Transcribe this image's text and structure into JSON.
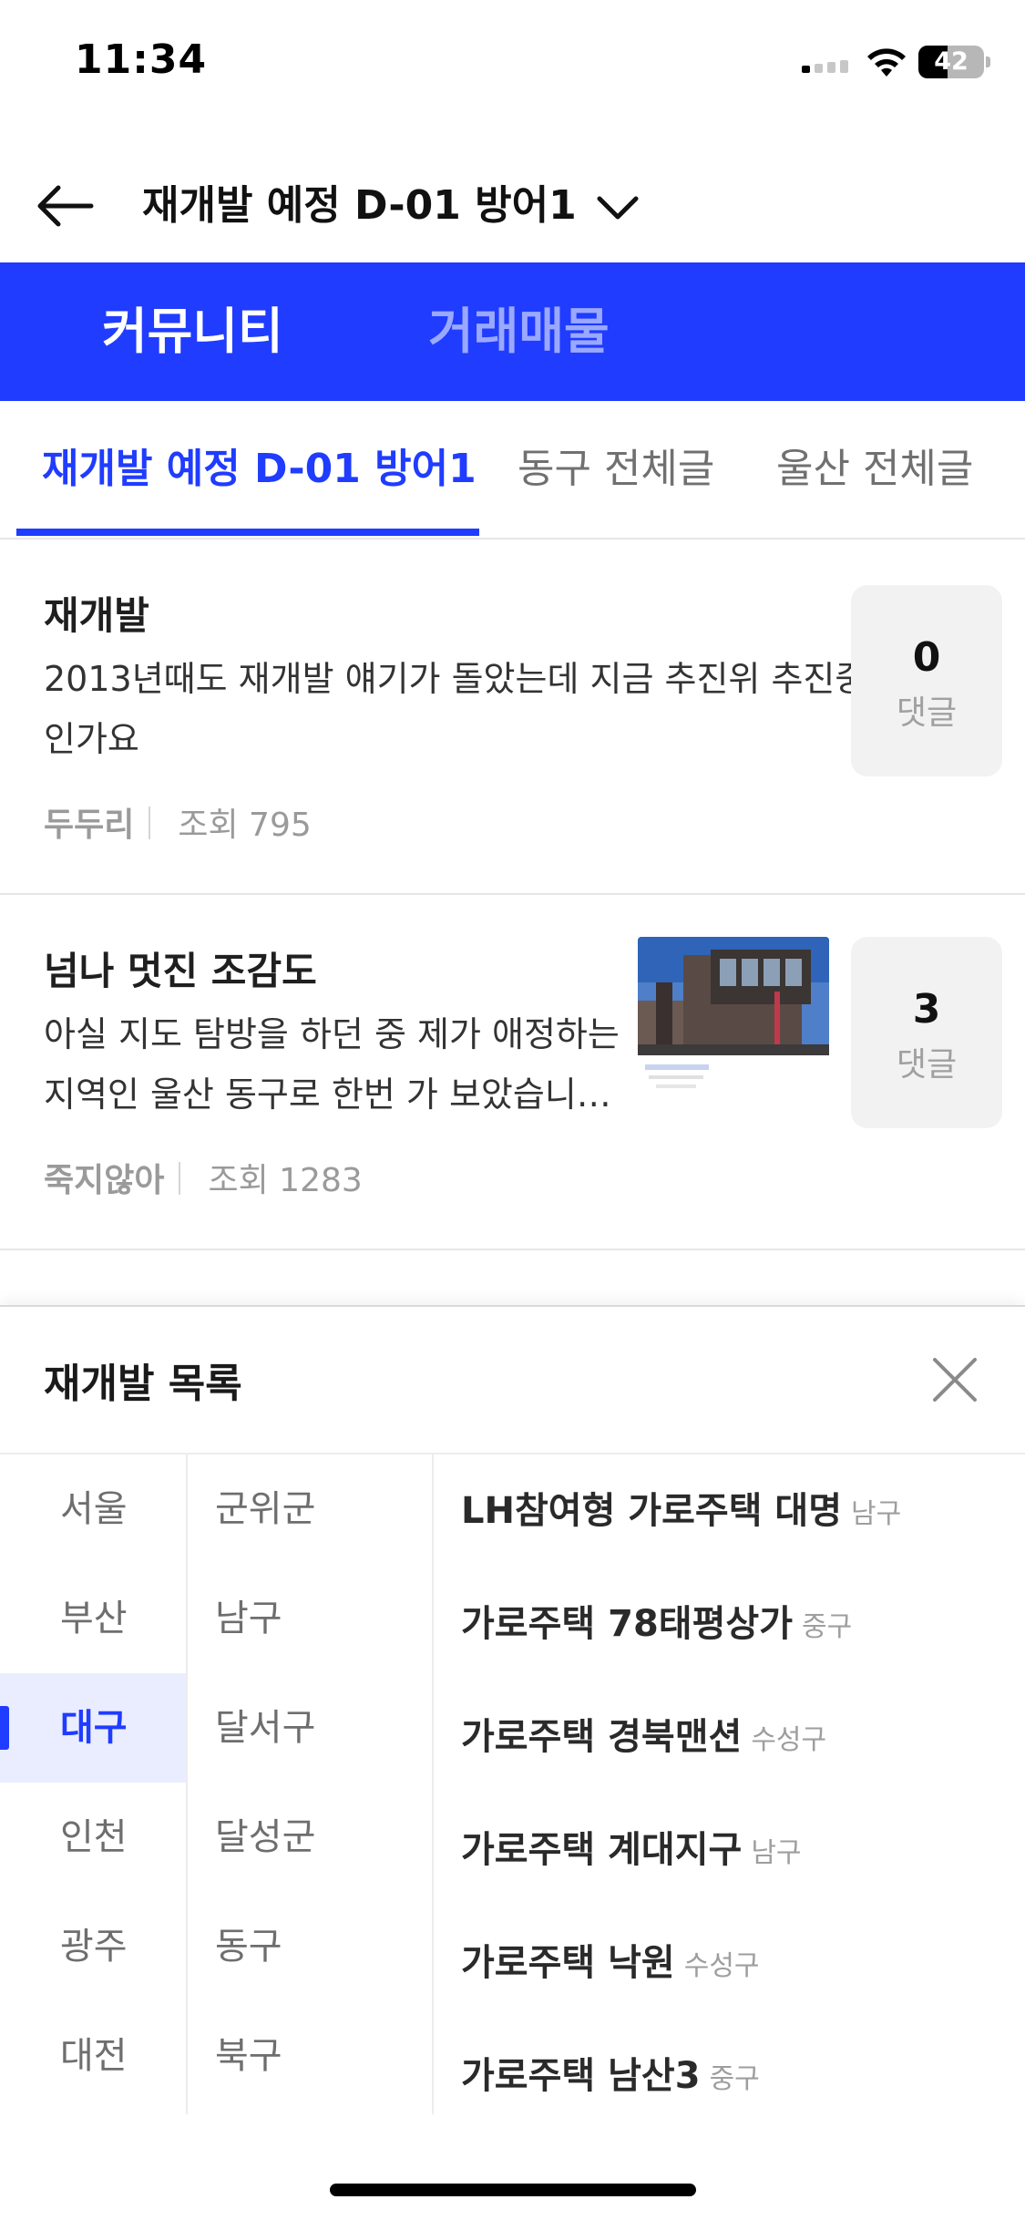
{
  "status_bar": {
    "time": "11:34",
    "battery_level": "42"
  },
  "header": {
    "title": "재개발 예정 D-01 방어1"
  },
  "main_tabs": [
    {
      "label": "커뮤니티",
      "active": true
    },
    {
      "label": "거래매물",
      "active": false
    }
  ],
  "sub_tabs": [
    {
      "label": "재개발 예정 D-01 방어1",
      "active": true
    },
    {
      "label": "동구 전체글",
      "active": false
    },
    {
      "label": "울산 전체글",
      "active": false
    }
  ],
  "posts": [
    {
      "title": "재개발",
      "body_line1": "2013년때도 재개발 얘기가 돌았는데 지금 추진위 추진중",
      "body_line2": "인가요",
      "author": "두두리",
      "views": "조회 795",
      "comment_count": "0",
      "comment_label": "댓글",
      "has_image": false
    },
    {
      "title": "넘나 멋진 조감도",
      "body_line1": "아실 지도 탐방을 하던 중 제가 애정하는",
      "body_line2": "지역인 울산 동구로 한번 가 보았습니…",
      "author": "죽지않아",
      "views": "조회 1283",
      "comment_count": "3",
      "comment_label": "댓글",
      "has_image": true
    }
  ],
  "sheet": {
    "title": "재개발 목록",
    "cities": [
      {
        "label": "서울"
      },
      {
        "label": "부산"
      },
      {
        "label": "대구",
        "selected": true
      },
      {
        "label": "인천"
      },
      {
        "label": "광주"
      },
      {
        "label": "대전"
      }
    ],
    "districts": [
      {
        "label": "군위군"
      },
      {
        "label": "남구"
      },
      {
        "label": "달서구"
      },
      {
        "label": "달성군"
      },
      {
        "label": "동구"
      },
      {
        "label": "북구"
      }
    ],
    "projects": [
      {
        "name": "LH참여형 가로주택 대명",
        "area": "남구"
      },
      {
        "name": "가로주택 78태평상가",
        "area": "중구"
      },
      {
        "name": "가로주택 경북맨션",
        "area": "수성구"
      },
      {
        "name": "가로주택 계대지구",
        "area": "남구"
      },
      {
        "name": "가로주택 낙원",
        "area": "수성구"
      },
      {
        "name": "가로주택 남산3",
        "area": "중구"
      }
    ]
  },
  "colors": {
    "accent": "#1f3cff",
    "accent_light": "#eaedff",
    "inactive_tab": "#9aa8ff"
  },
  "icons": {
    "back": "arrow-left-icon",
    "dropdown": "chevron-down-icon",
    "close": "close-icon",
    "wifi": "wifi-icon",
    "battery": "battery-icon",
    "signal": "signal-icon"
  }
}
